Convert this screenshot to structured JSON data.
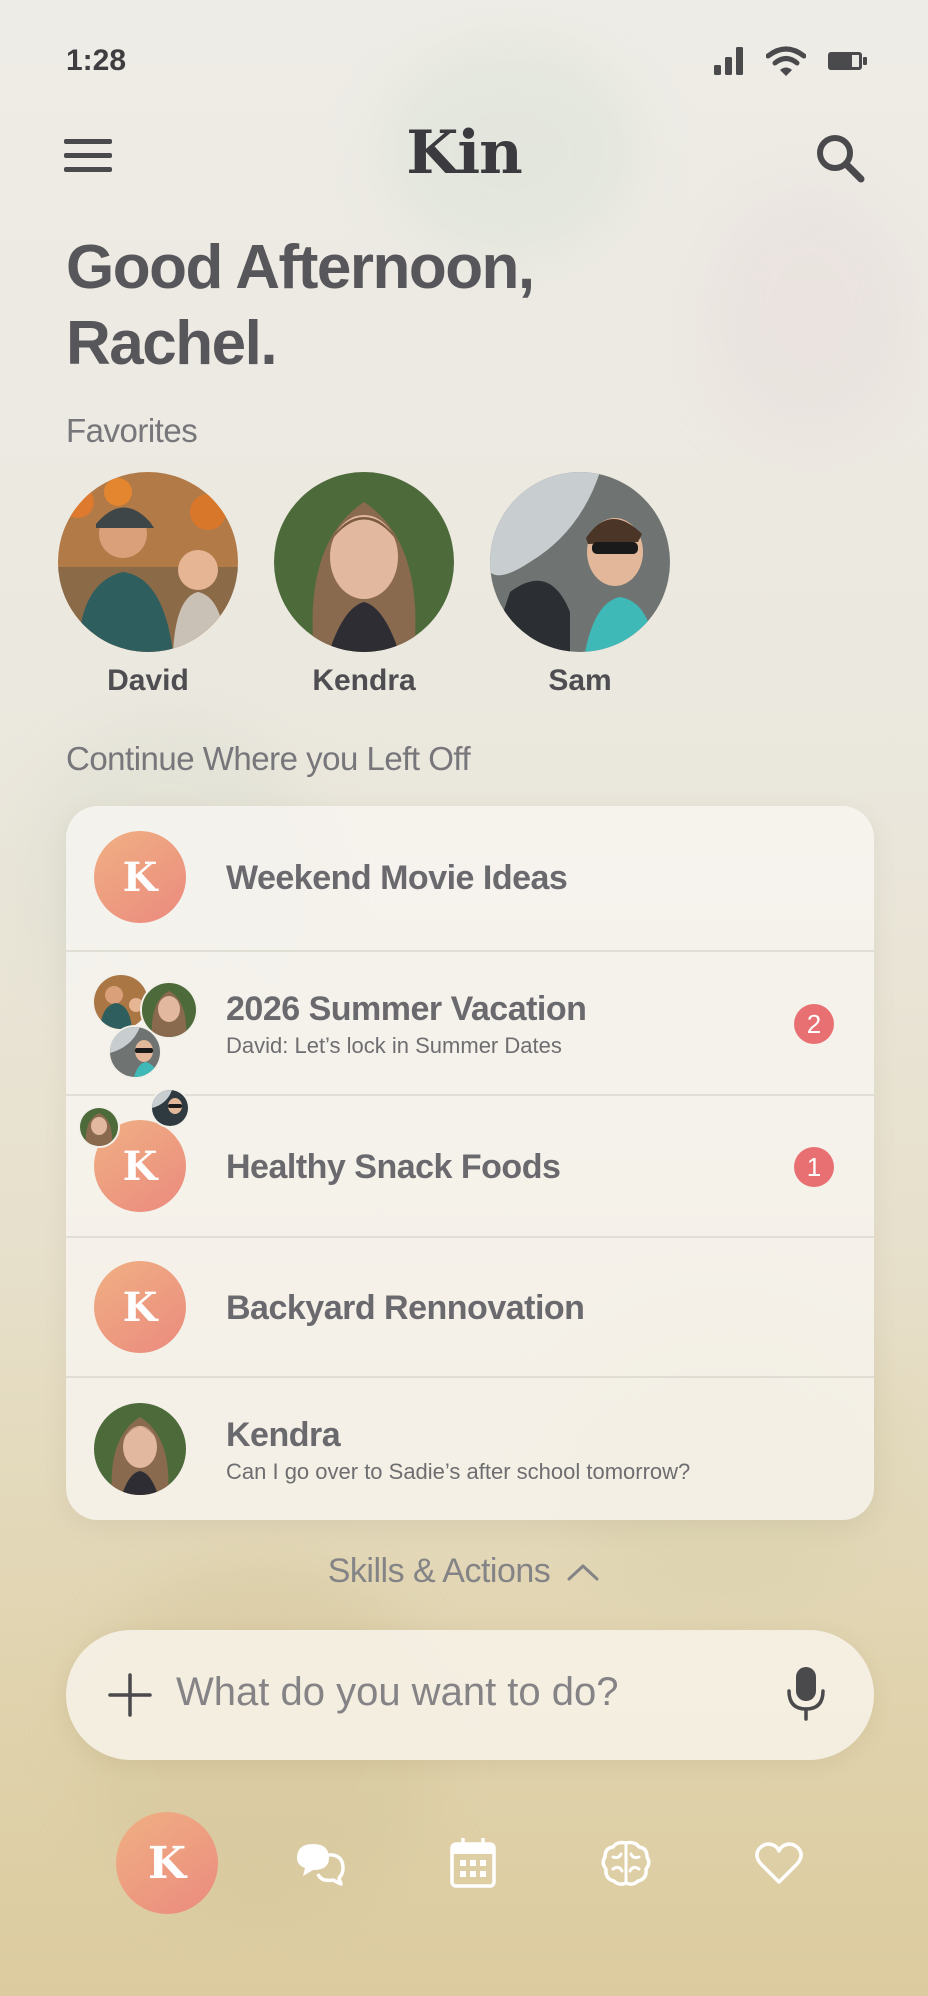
{
  "status_bar": {
    "time": "1:28"
  },
  "header": {
    "brand": "Kin"
  },
  "greeting": {
    "line1": "Good Afternoon,",
    "line2": "Rachel."
  },
  "favorites": {
    "label": "Favorites",
    "people": [
      {
        "name": "David"
      },
      {
        "name": "Kendra"
      },
      {
        "name": "Sam"
      }
    ]
  },
  "continue": {
    "label": "Continue Where you Left Off",
    "items": [
      {
        "title": "Weekend Movie Ideas",
        "subtitle": "",
        "badge": "K"
      },
      {
        "title": "2026 Summer Vacation",
        "subtitle": "David: Let’s lock in Summer Dates",
        "unread": "2"
      },
      {
        "title": "Healthy Snack Foods",
        "subtitle": "",
        "badge": "K",
        "unread": "1"
      },
      {
        "title": "Backyard Rennovation",
        "subtitle": "",
        "badge": "K"
      },
      {
        "title": "Kendra",
        "subtitle": "Can I go over to Sadie’s after school tomorrow?"
      }
    ]
  },
  "skills": {
    "label": "Skills & Actions"
  },
  "composer": {
    "placeholder": "What do you want to do?"
  },
  "tabbar": {
    "home_badge": "K"
  },
  "colors": {
    "accent_gradient_start": "#f0b083",
    "accent_gradient_end": "#eb8a7e",
    "unread": "#e97072"
  },
  "icons": [
    "menu-icon",
    "search-icon",
    "signal-icon",
    "wifi-icon",
    "battery-icon",
    "plus-icon",
    "microphone-icon",
    "chevron-up-icon",
    "chat-bubbles-icon",
    "calendar-icon",
    "brain-icon",
    "heart-icon"
  ]
}
